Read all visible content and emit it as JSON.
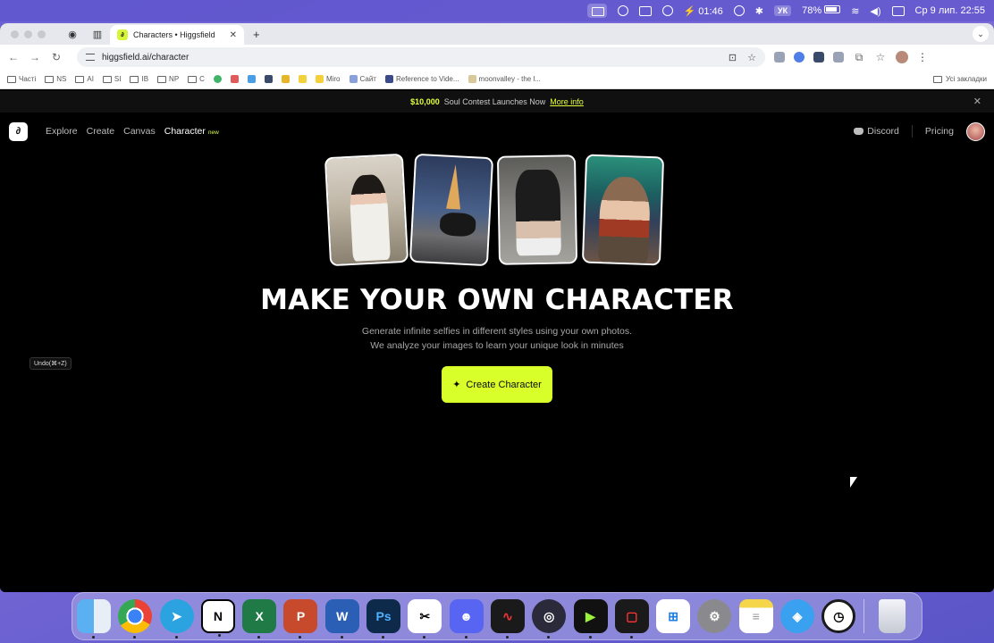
{
  "menubar": {
    "time_label": "01:46",
    "keyboard": "УК",
    "battery": "78%",
    "datetime": "Ср 9 лип.  22:55"
  },
  "browser": {
    "tab_title": "Characters • Higgsfield",
    "url": "higgsfield.ai/character",
    "bookmarks": [
      "Часті",
      "NS",
      "AI",
      "SI",
      "IB",
      "NP",
      "C",
      "Miro",
      "Сайт",
      "Reference to Vide...",
      "moonvalley - the l..."
    ],
    "all_bookmarks": "Усі закладки"
  },
  "banner": {
    "prize": "$10,000",
    "text": "Soul Contest Launches Now",
    "link": "More info"
  },
  "nav": {
    "links": [
      "Explore",
      "Create",
      "Canvas"
    ],
    "active": "Character",
    "badge": "new",
    "discord": "Discord",
    "pricing": "Pricing"
  },
  "hero": {
    "headline": "MAKE YOUR OWN CHARACTER",
    "subtitle_line1": "Generate infinite selfies in different styles using your own photos.",
    "subtitle_line2": "We analyze your images to learn your unique look in minutes",
    "cta": "Create Character"
  },
  "tooltip": "Undo(⌘+Z)",
  "dock": {
    "apps": [
      "finder",
      "chrome",
      "telegram",
      "notion",
      "excel",
      "powerpoint",
      "word",
      "photoshop",
      "capcut",
      "discord",
      "voice-recorder",
      "obs",
      "filmora",
      "screen-recorder",
      "windows-app",
      "system-settings",
      "notes",
      "safari",
      "clock",
      "trash"
    ],
    "colors": {
      "finder": "#3a8dde",
      "chrome": "#ffffff",
      "telegram": "#2aa3e0",
      "notion": "#ffffff",
      "excel": "#1f7a45",
      "powerpoint": "#c84a2c",
      "word": "#2b5fb5",
      "photoshop": "#0e2a4a",
      "capcut": "#ffffff",
      "discord": "#5865f2",
      "voice-recorder": "#1a1a1a",
      "obs": "#2a2a3a",
      "filmora": "#111111",
      "screen-recorder": "#1a1a1a",
      "windows-app": "#ffffff",
      "system-settings": "#8a8a8e",
      "notes": "#f5d54a",
      "safari": "#3aa0f0",
      "clock": "#1a1a1a",
      "trash": "#d8dce6"
    }
  },
  "colors": {
    "accent": "#d8ff2a",
    "banner_accent": "#e3ff3a"
  }
}
